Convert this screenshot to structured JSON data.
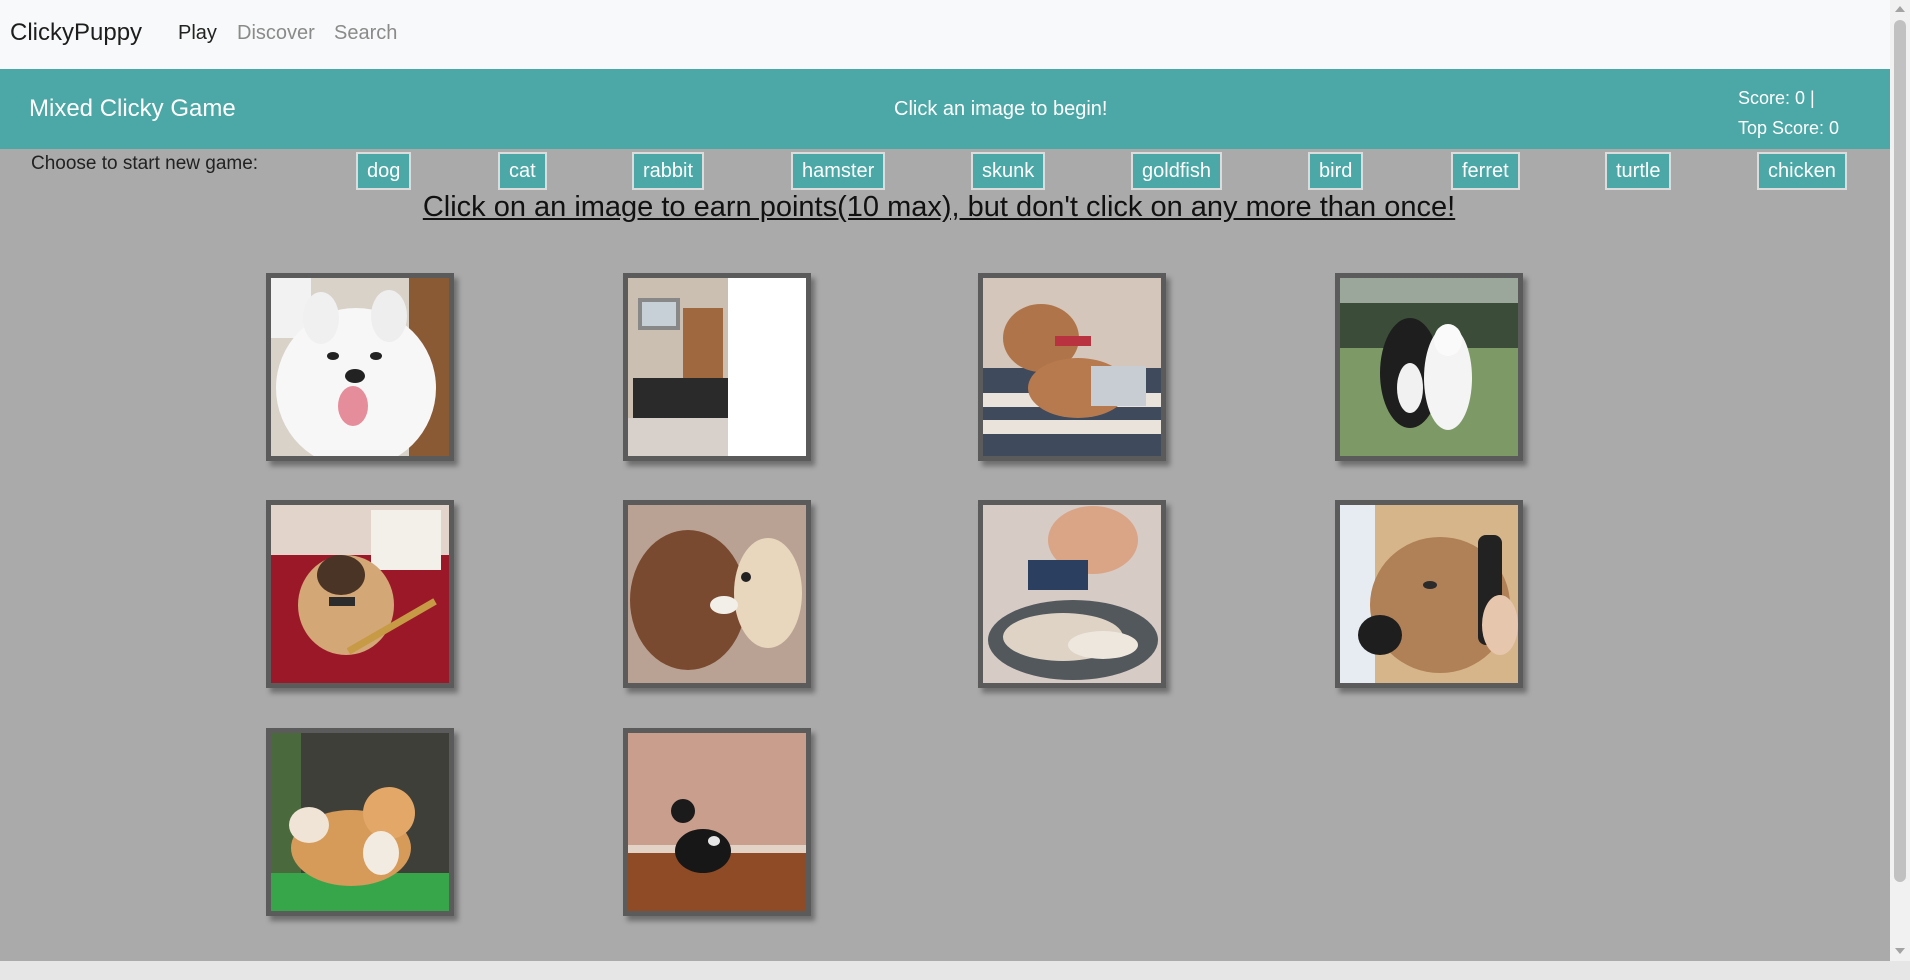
{
  "navbar": {
    "brand": "ClickyPuppy",
    "links": [
      "Play",
      "Discover",
      "Search"
    ]
  },
  "header": {
    "title": "Mixed Clicky Game",
    "message": "Click an image to begin!",
    "score": "Score: 0 |",
    "top_score": "Top Score: 0"
  },
  "chooser": {
    "label": "Choose to start new game:",
    "animals": [
      "dog",
      "cat",
      "rabbit",
      "hamster",
      "skunk",
      "goldfish",
      "bird",
      "ferret",
      "turtle",
      "chicken"
    ]
  },
  "instructions": "Click on an image to earn points(10 max), but don't click on any more than once!",
  "cards": [
    "samoyed-photo",
    "tv-room-cat-photo",
    "shiba-on-laptop-photo",
    "two-dogs-on-grass-photo",
    "pug-with-bowtie-photo",
    "poodle-and-dog-photo",
    "dog-bath-photo",
    "dog-on-phone-photo",
    "shiba-inu-photo",
    "dachshund-photo"
  ],
  "colors": {
    "accent": "#4ba8a6",
    "background": "#aaaaaa"
  }
}
